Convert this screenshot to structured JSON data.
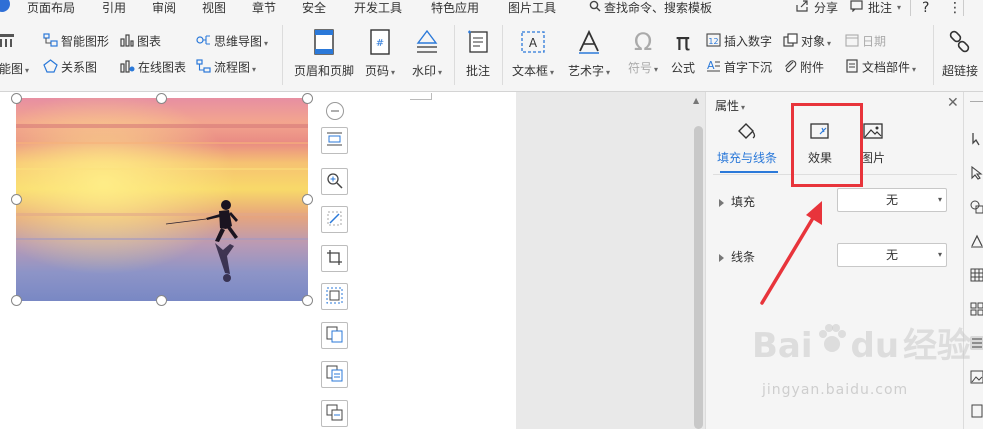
{
  "menubar": {
    "items": [
      "页面布局",
      "引用",
      "审阅",
      "视图",
      "章节",
      "安全",
      "开发工具",
      "特色应用",
      "图片工具"
    ],
    "search": "查找命令、搜索模板",
    "share": "分享",
    "comment": "批注",
    "help": "?",
    "more": "⋮"
  },
  "ribbon": {
    "col1": [
      "智能图形",
      "关系图"
    ],
    "col1_partial": "能图",
    "col2": [
      "图表",
      "在线图表"
    ],
    "col3": [
      "思维导图",
      "流程图"
    ],
    "big": {
      "header_footer": "页眉和页脚",
      "page_number": "页码",
      "watermark": "水印",
      "comment": "批注",
      "textbox": "文本框",
      "wordart": "艺术字",
      "symbol": "符号",
      "formula": "公式",
      "hyperlink": "超链接"
    },
    "small": {
      "insert_number": "插入数字",
      "object": "对象",
      "date": "日期",
      "dropcap": "首字下沉",
      "attachment": "附件",
      "doc_parts": "文档部件"
    }
  },
  "panel": {
    "title": "属性",
    "tabs": [
      "填充与线条",
      "效果",
      "图片"
    ],
    "active_tab": 0,
    "rows": [
      {
        "label": "填充",
        "value": "无"
      },
      {
        "label": "线条",
        "value": "无"
      }
    ]
  },
  "watermark": {
    "brand_a": "Bai",
    "brand_b": "du",
    "brand_c": "经验",
    "url": "jingyan.baidu.com"
  },
  "colors": {
    "accent": "#2b79d9",
    "highlight": "#e8343b",
    "ribbon_bg": "#f5f5f5"
  }
}
